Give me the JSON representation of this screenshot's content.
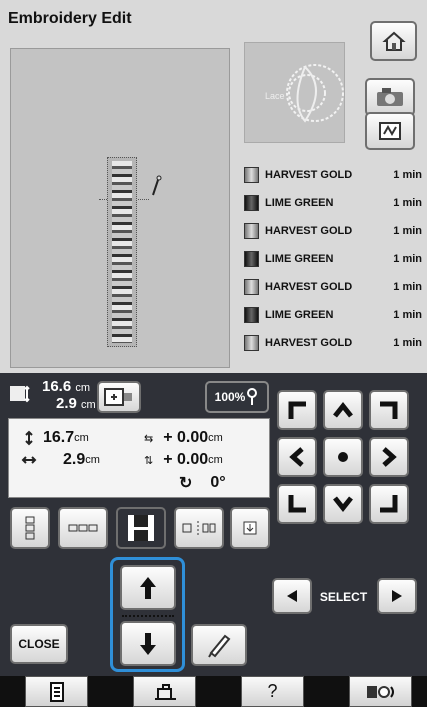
{
  "title": "Embroidery Edit",
  "threads": [
    {
      "name": "HARVEST GOLD",
      "time": "1 min",
      "spool": "light"
    },
    {
      "name": "LIME GREEN",
      "time": "1 min",
      "spool": "dark"
    },
    {
      "name": "HARVEST GOLD",
      "time": "1 min",
      "spool": "light"
    },
    {
      "name": "LIME GREEN",
      "time": "1 min",
      "spool": "dark"
    },
    {
      "name": "HARVEST GOLD",
      "time": "1 min",
      "spool": "light"
    },
    {
      "name": "LIME GREEN",
      "time": "1 min",
      "spool": "dark"
    },
    {
      "name": "HARVEST GOLD",
      "time": "1 min",
      "spool": "light"
    }
  ],
  "size": {
    "height": "16.6",
    "width": "2.9",
    "unit": "cm"
  },
  "zoom": "100%",
  "dimensions": {
    "height": "16.7",
    "width": "2.9",
    "unit": "cm"
  },
  "offset": {
    "x": "+ 0.00",
    "y": "+ 0.00",
    "unit": "cm",
    "rotation": "0°"
  },
  "buttons": {
    "close": "CLOSE",
    "select": "SELECT",
    "help": "?"
  }
}
